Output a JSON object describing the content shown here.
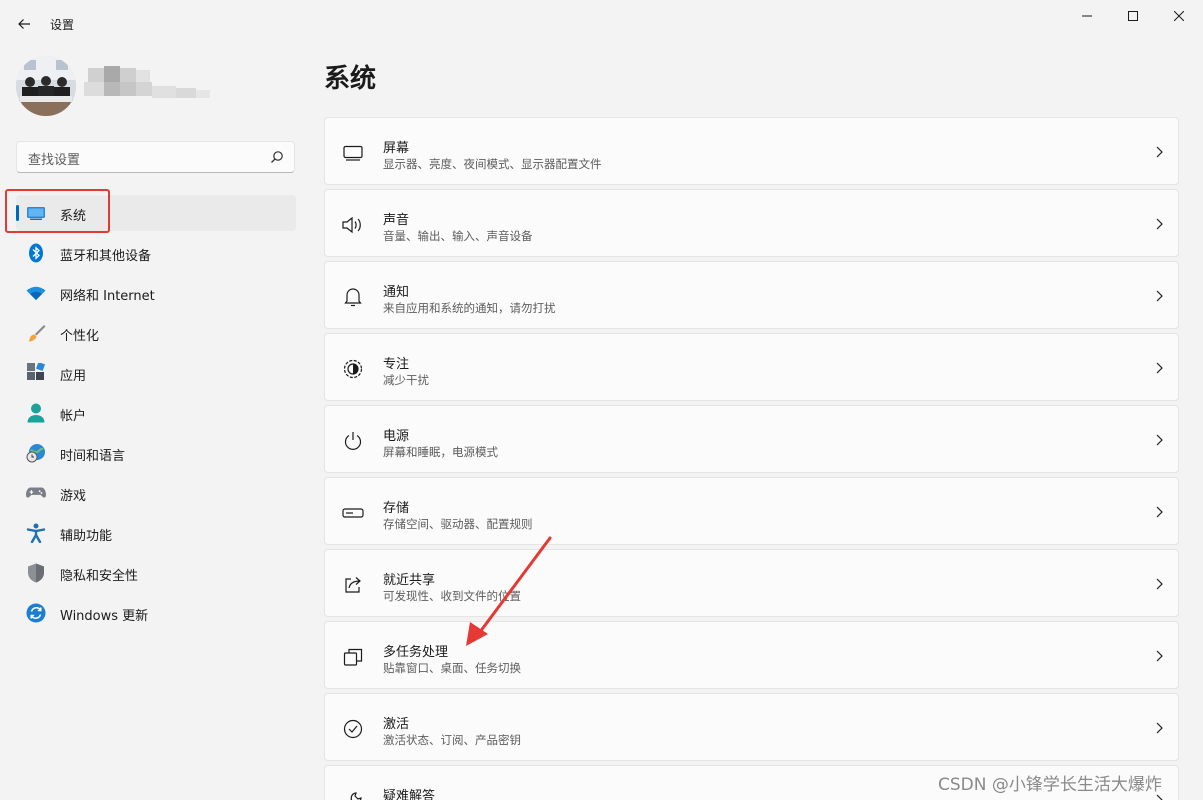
{
  "window": {
    "title": "设置"
  },
  "search": {
    "placeholder": "查找设置"
  },
  "nav": {
    "items": [
      {
        "label": "系统",
        "selected": true,
        "icon": "system-icon"
      },
      {
        "label": "蓝牙和其他设备",
        "icon": "bluetooth-icon"
      },
      {
        "label": "网络和 Internet",
        "icon": "wifi-icon"
      },
      {
        "label": "个性化",
        "icon": "brush-icon"
      },
      {
        "label": "应用",
        "icon": "apps-icon"
      },
      {
        "label": "帐户",
        "icon": "account-icon"
      },
      {
        "label": "时间和语言",
        "icon": "globe-clock-icon"
      },
      {
        "label": "游戏",
        "icon": "gamepad-icon"
      },
      {
        "label": "辅助功能",
        "icon": "accessibility-icon"
      },
      {
        "label": "隐私和安全性",
        "icon": "shield-icon"
      },
      {
        "label": "Windows 更新",
        "icon": "update-icon"
      }
    ]
  },
  "main": {
    "title": "系统",
    "cards": [
      {
        "title": "屏幕",
        "subtitle": "显示器、亮度、夜间模式、显示器配置文件",
        "icon": "display-icon"
      },
      {
        "title": "声音",
        "subtitle": "音量、输出、输入、声音设备",
        "icon": "speaker-icon"
      },
      {
        "title": "通知",
        "subtitle": "来自应用和系统的通知，请勿打扰",
        "icon": "bell-icon"
      },
      {
        "title": "专注",
        "subtitle": "减少干扰",
        "icon": "focus-icon"
      },
      {
        "title": "电源",
        "subtitle": "屏幕和睡眠，电源模式",
        "icon": "power-icon"
      },
      {
        "title": "存储",
        "subtitle": "存储空间、驱动器、配置规则",
        "icon": "storage-icon"
      },
      {
        "title": "就近共享",
        "subtitle": "可发现性、收到文件的位置",
        "icon": "share-icon"
      },
      {
        "title": "多任务处理",
        "subtitle": "贴靠窗口、桌面、任务切换",
        "icon": "multitask-icon"
      },
      {
        "title": "激活",
        "subtitle": "激活状态、订阅、产品密钥",
        "icon": "check-circle-icon"
      },
      {
        "title": "疑难解答",
        "subtitle": "",
        "icon": "wrench-icon"
      }
    ]
  },
  "colors": {
    "accent": "#0067c0",
    "annotation": "#e53935"
  },
  "watermark": "CSDN @小锋学长生活大爆炸"
}
